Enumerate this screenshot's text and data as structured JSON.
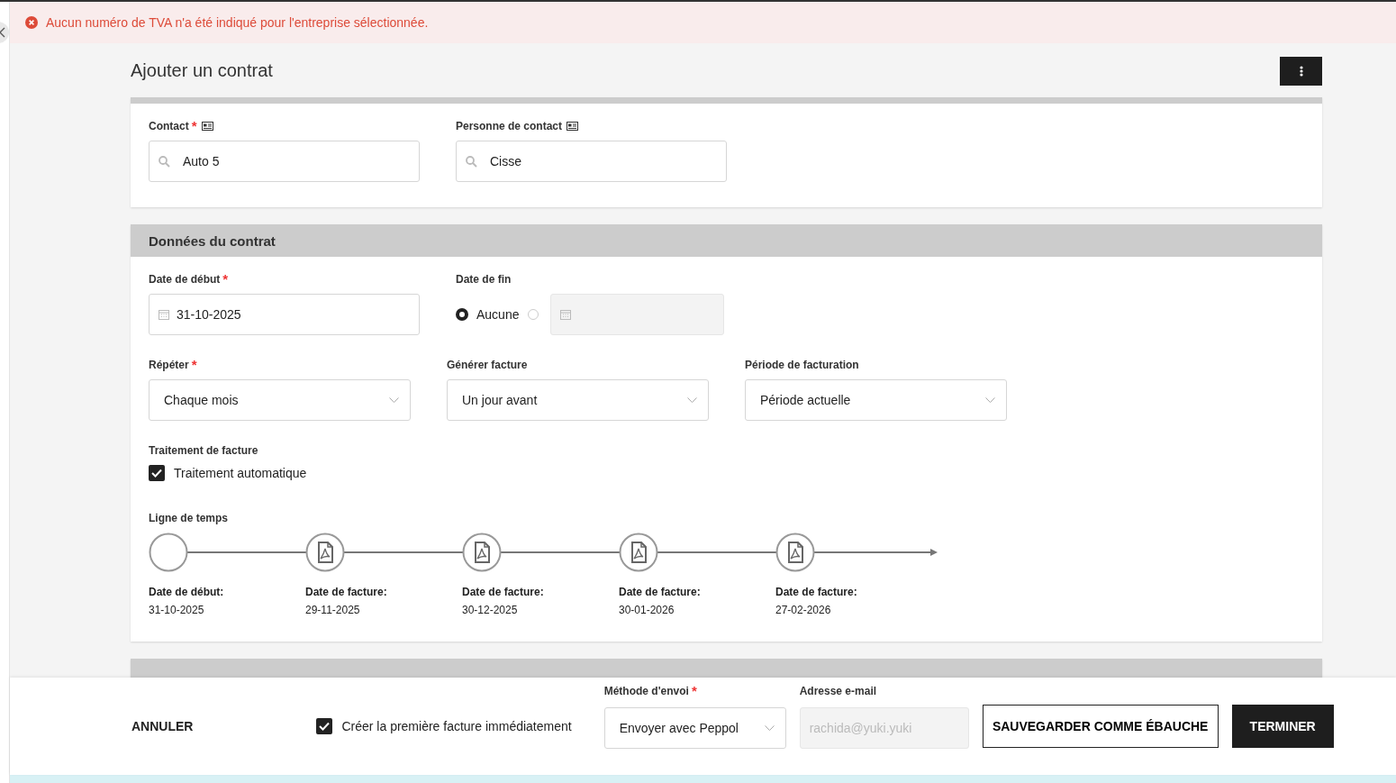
{
  "alert": {
    "text": "Aucun numéro de TVA n'a été indiqué pour l'entreprise sélectionnée."
  },
  "title": "Ajouter un contrat",
  "contact_fields": [
    {
      "label": "Contact",
      "required_mark": "*",
      "value": "Auto 5"
    },
    {
      "label": "Personne de contact",
      "value": "Cisse"
    }
  ],
  "contract_data": {
    "title": "Données du contrat",
    "start_date": {
      "label": "Date de début",
      "required_mark": "*",
      "value": "31-10-2025"
    },
    "end_date": {
      "label": "Date de fin",
      "none_option": {
        "label": "Aucune",
        "selected": true
      },
      "date_option": {
        "selected": false
      }
    },
    "selects": [
      {
        "label": "Répéter",
        "required_mark": "*",
        "value": "Chaque mois"
      },
      {
        "label": "Générer facture",
        "value": "Un jour avant"
      },
      {
        "label": "Période de facturation",
        "value": "Période actuelle"
      }
    ],
    "processing": {
      "label": "Traitement de facture",
      "option": {
        "label": "Traitement automatique",
        "checked": true
      }
    },
    "timeline": {
      "label": "Ligne de temps",
      "events": [
        {
          "kind": "start",
          "label": "Date de début:",
          "date": "31-10-2025"
        },
        {
          "kind": "invoice",
          "label": "Date de facture:",
          "date": "29-11-2025"
        },
        {
          "kind": "invoice",
          "label": "Date de facture:",
          "date": "30-12-2025"
        },
        {
          "kind": "invoice",
          "label": "Date de facture:",
          "date": "30-01-2026"
        },
        {
          "kind": "invoice",
          "label": "Date de facture:",
          "date": "27-02-2026"
        }
      ]
    }
  },
  "footer": {
    "cancel": "ANNULER",
    "first_invoice": {
      "label": "Créer la première facture immédiatement",
      "checked": true
    },
    "send_method": {
      "label": "Méthode d'envoi",
      "required_mark": "*",
      "value": "Envoyer avec Peppol"
    },
    "email": {
      "label": "Adresse e-mail",
      "value": "rachida@yuki.yuki",
      "disabled": true
    },
    "save_draft": "SAUVEGARDER COMME ÉBAUCHE",
    "finish": "TERMINER"
  }
}
